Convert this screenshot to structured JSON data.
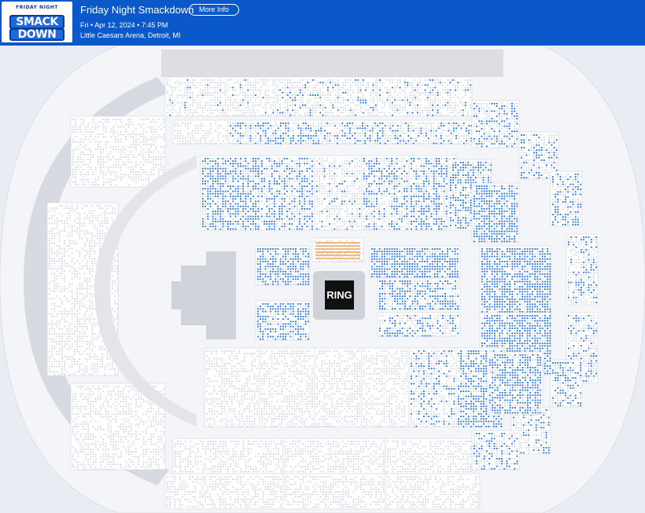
{
  "event": {
    "logo_tag": "FRIDAY NIGHT",
    "logo_line1": "SMACK",
    "logo_line2": "DOWN",
    "title": "Friday Night Smackdown",
    "more_info_label": "More Info",
    "date_time": "Fri • Apr 12, 2024 • 7:45 PM",
    "venue": "Little Caesars Arena, Detroit, MI"
  },
  "map": {
    "ring_label": "RING",
    "colors": {
      "available_seat": "#1f6fe0",
      "unavailable_seat": "#d4d7de",
      "floor_premium": "#f0b87a",
      "section_fill": "#ffffff",
      "concourse": "#d7dae1",
      "outer": "#f4f5f8"
    }
  }
}
